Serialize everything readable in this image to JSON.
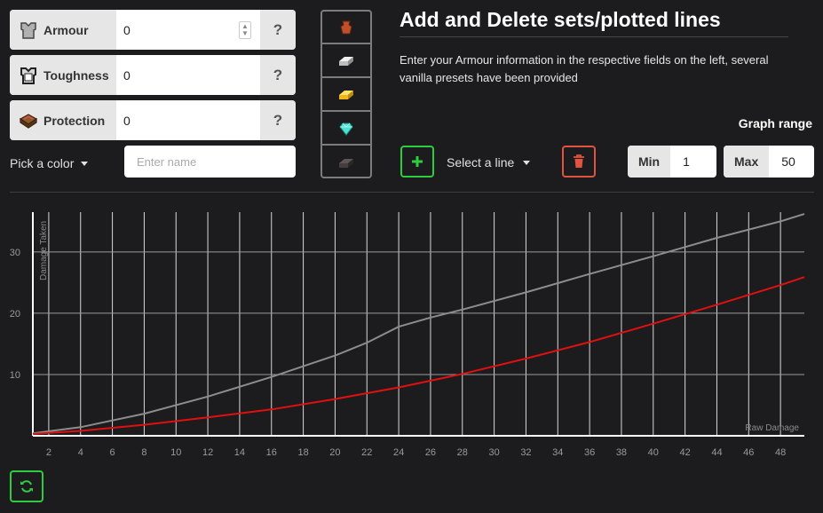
{
  "stats": [
    {
      "label": "Armour",
      "value": "0",
      "help": "?",
      "icon": "chestplate-icon"
    },
    {
      "label": "Toughness",
      "value": "0",
      "help": "?",
      "icon": "chestplate-outline-icon"
    },
    {
      "label": "Protection",
      "value": "0",
      "help": "?",
      "icon": "enchanted-book-icon"
    }
  ],
  "color_picker": {
    "label": "Pick a color"
  },
  "name_input": {
    "placeholder": "Enter name"
  },
  "presets": [
    {
      "name": "leather",
      "icon": "leather-icon",
      "color": "#c0502a"
    },
    {
      "name": "iron",
      "icon": "iron-ingot-icon",
      "color": "#d8d8d8"
    },
    {
      "name": "gold",
      "icon": "gold-ingot-icon",
      "color": "#f2c53d"
    },
    {
      "name": "diamond",
      "icon": "diamond-icon",
      "color": "#4ee0d0"
    },
    {
      "name": "netherite",
      "icon": "netherite-ingot-icon",
      "color": "#4a4444"
    }
  ],
  "header": {
    "title": "Add and Delete sets/plotted lines",
    "description": "Enter your Armour information in the respective fields on the left, several vanilla presets have been provided"
  },
  "line_select": {
    "label": "Select a line"
  },
  "graph_range": {
    "label": "Graph range",
    "min_label": "Min",
    "min_value": "1",
    "max_label": "Max",
    "max_value": "50"
  },
  "chart_data": {
    "type": "line",
    "xlabel": "Raw Damage",
    "ylabel": "Damage Taken",
    "xlim": [
      1,
      49.5
    ],
    "ylim": [
      0,
      36.5
    ],
    "xticks": [
      2,
      4,
      6,
      8,
      10,
      12,
      14,
      16,
      18,
      20,
      22,
      24,
      26,
      28,
      30,
      32,
      34,
      36,
      38,
      40,
      42,
      44,
      46,
      48
    ],
    "yticks": [
      10,
      20,
      30
    ],
    "grid": true,
    "series": [
      {
        "color": "#8c8c8c",
        "x": [
          1,
          4,
          8,
          12,
          16,
          20,
          22,
          24,
          26,
          28,
          32,
          36,
          40,
          44,
          48,
          49.5
        ],
        "y": [
          0.4,
          1.4,
          3.6,
          6.4,
          9.6,
          13.1,
          15.2,
          17.8,
          19.3,
          20.6,
          23.4,
          26.4,
          29.3,
          32.3,
          35.0,
          36.2
        ]
      },
      {
        "color": "#e01010",
        "x": [
          1,
          4,
          8,
          12,
          16,
          20,
          24,
          28,
          32,
          36,
          40,
          44,
          48,
          49.5
        ],
        "y": [
          0.3,
          0.8,
          1.8,
          3.0,
          4.3,
          6.0,
          7.9,
          10.1,
          12.6,
          15.3,
          18.3,
          21.4,
          24.6,
          25.9
        ]
      }
    ]
  },
  "refresh": {
    "icon": "refresh-icon"
  }
}
